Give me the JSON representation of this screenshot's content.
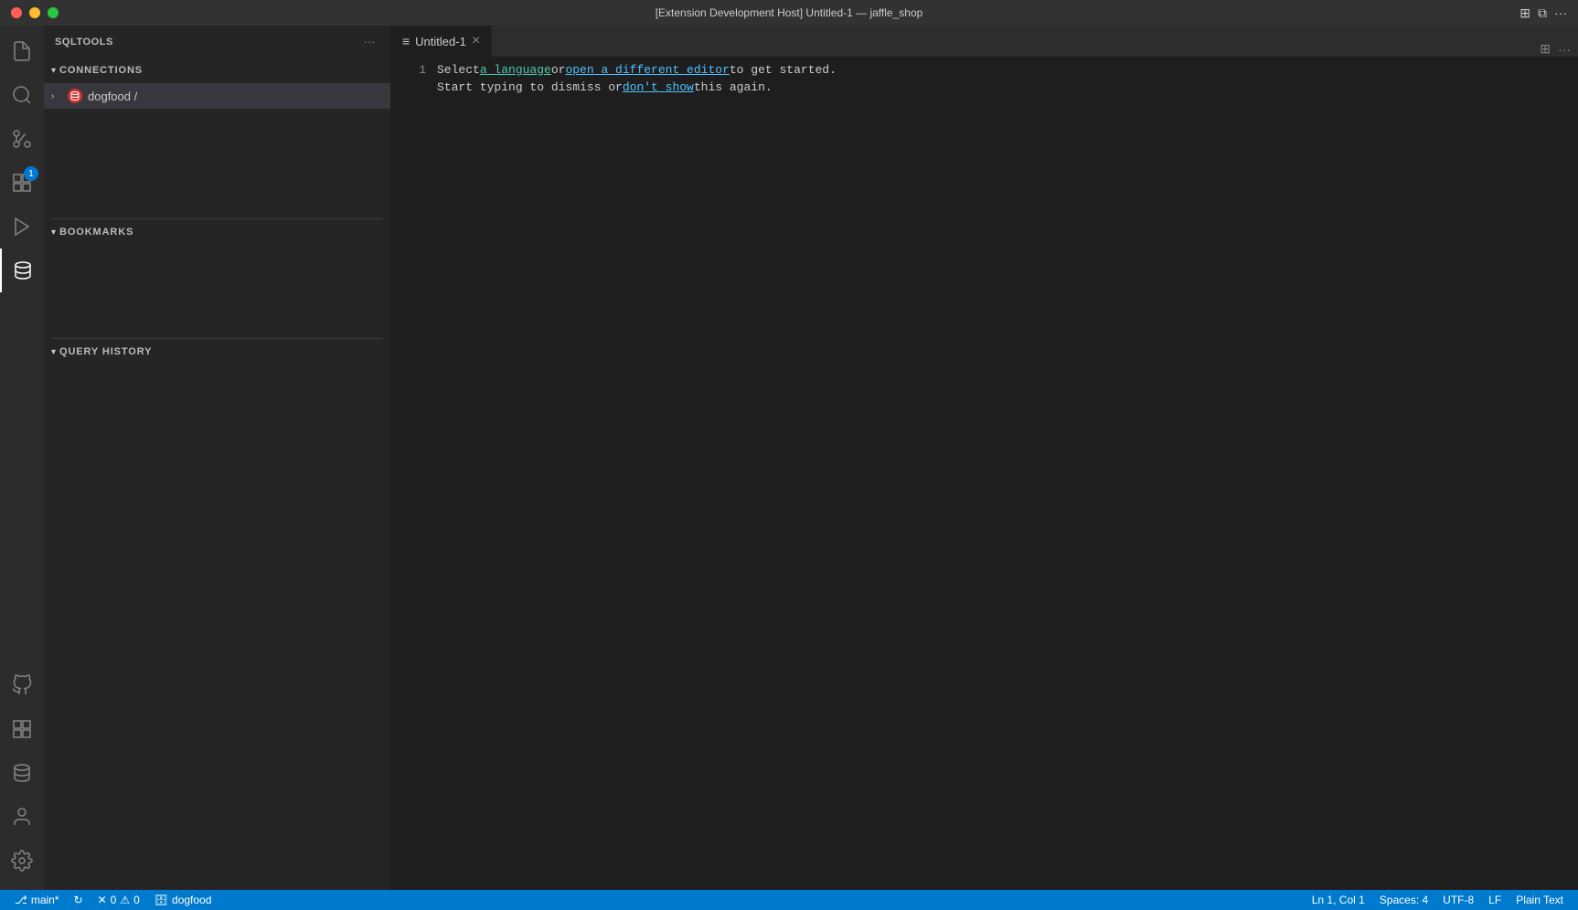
{
  "titlebar": {
    "title": "[Extension Development Host] Untitled-1 — jaffle_shop",
    "dots": [
      "close",
      "minimize",
      "maximize"
    ]
  },
  "activitybar": {
    "icons": [
      {
        "name": "files-icon",
        "label": "Explorer",
        "active": false
      },
      {
        "name": "search-icon",
        "label": "Search",
        "active": false
      },
      {
        "name": "source-control-icon",
        "label": "Source Control",
        "active": false
      },
      {
        "name": "extensions-icon",
        "label": "Extensions",
        "active": false,
        "badge": "1"
      },
      {
        "name": "run-icon",
        "label": "Run",
        "active": false
      },
      {
        "name": "sqltools-icon",
        "label": "SQLTools",
        "active": true
      }
    ],
    "bottom": [
      {
        "name": "github-icon",
        "label": "GitHub"
      },
      {
        "name": "extensions-bottom-icon",
        "label": "Extensions"
      },
      {
        "name": "database-icon",
        "label": "Database"
      },
      {
        "name": "account-icon",
        "label": "Account"
      },
      {
        "name": "settings-icon",
        "label": "Settings"
      }
    ]
  },
  "sidebar": {
    "title": "SQLTOOLS",
    "sections": [
      {
        "id": "connections",
        "label": "CONNECTIONS",
        "expanded": true,
        "items": [
          {
            "name": "dogfood",
            "suffix": "/",
            "icon": "db"
          }
        ]
      },
      {
        "id": "bookmarks",
        "label": "BOOKMARKS",
        "expanded": true,
        "items": []
      },
      {
        "id": "query-history",
        "label": "QUERY HISTORY",
        "expanded": true,
        "items": []
      }
    ]
  },
  "editor": {
    "tab": {
      "label": "Untitled-1",
      "icon": "≡",
      "modified": false
    },
    "line1": {
      "parts": [
        {
          "text": "Select",
          "style": "plain"
        },
        {
          "text": " a language",
          "style": "link"
        },
        {
          "text": " or ",
          "style": "plain"
        },
        {
          "text": "open a different editor",
          "style": "link-blue"
        },
        {
          "text": " to get started.",
          "style": "plain"
        }
      ]
    },
    "line2": {
      "parts": [
        {
          "text": "Start typing to dismiss or ",
          "style": "plain"
        },
        {
          "text": "don't show",
          "style": "link-blue"
        },
        {
          "text": " this again.",
          "style": "plain"
        }
      ]
    },
    "lineNumber": "1"
  },
  "statusbar": {
    "left": [
      {
        "icon": "branch-icon",
        "text": "main*",
        "name": "branch"
      },
      {
        "icon": "sync-icon",
        "text": "",
        "name": "sync"
      },
      {
        "icon": "error-icon",
        "text": "0",
        "name": "errors"
      },
      {
        "icon": "warning-icon",
        "text": "0",
        "name": "warnings"
      },
      {
        "icon": "db-status-icon",
        "text": "dogfood",
        "name": "db-connection"
      }
    ],
    "right": [
      {
        "text": "Ln 1, Col 1",
        "name": "cursor-position"
      },
      {
        "text": "Spaces: 4",
        "name": "indentation"
      },
      {
        "text": "UTF-8",
        "name": "encoding"
      },
      {
        "text": "LF",
        "name": "line-ending"
      },
      {
        "text": "Plain Text",
        "name": "language-mode"
      }
    ]
  }
}
